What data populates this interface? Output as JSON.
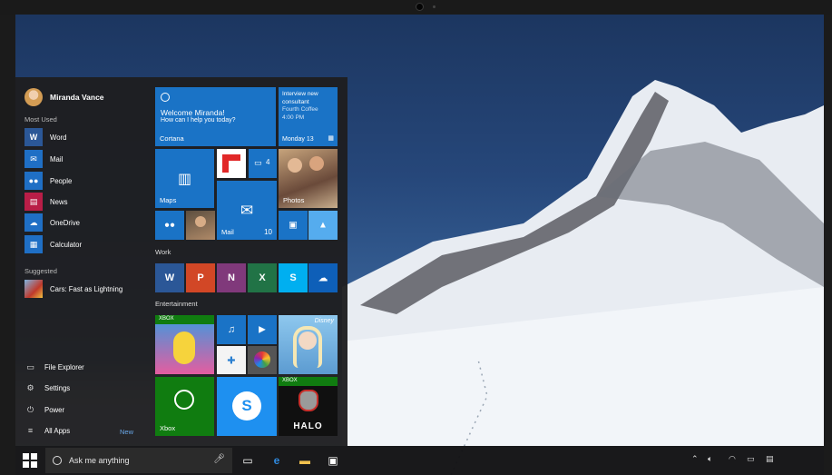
{
  "user": {
    "name": "Miranda Vance"
  },
  "sections": {
    "most_used": "Most Used",
    "suggested": "Suggested",
    "work": "Work",
    "entertainment": "Entertainment"
  },
  "most_used": [
    {
      "label": "Word",
      "icon": "W",
      "color": "#2b5797"
    },
    {
      "label": "Mail",
      "icon": "✉",
      "color": "#1f6fc5"
    },
    {
      "label": "People",
      "icon": "👥",
      "color": "#1f6fc5"
    },
    {
      "label": "News",
      "icon": "▤",
      "color": "#b91d47"
    },
    {
      "label": "OneDrive",
      "icon": "☁",
      "color": "#1f6fc5"
    },
    {
      "label": "Calculator",
      "icon": "▦",
      "color": "#1f6fc5"
    }
  ],
  "suggested": [
    {
      "label": "Cars: Fast as Lightning",
      "color": "#c0392b"
    }
  ],
  "system": [
    {
      "label": "File Explorer",
      "icon": "🗀"
    },
    {
      "label": "Settings",
      "icon": "⚙"
    },
    {
      "label": "Power",
      "icon": "⏻"
    },
    {
      "label": "All Apps",
      "icon": "≡"
    }
  ],
  "all_apps_badge": "New",
  "tiles": {
    "cortana": {
      "title": "Welcome Miranda!",
      "subtitle": "How can I help you today?",
      "label": "Cortana"
    },
    "calendar": {
      "line1": "Interview new",
      "line2": "consultant",
      "line3": "Fourth Coffee",
      "line4": "4:00 PM",
      "date": "Monday 13"
    },
    "maps": {
      "label": "Maps"
    },
    "messaging": {
      "count": "4"
    },
    "photos": {
      "label": "Photos"
    },
    "mail": {
      "label": "Mail",
      "count": "10"
    },
    "xbox_small": "XBOX",
    "disney": "Disney",
    "xbox": {
      "label": "Xbox"
    },
    "halo": "HALO"
  },
  "work_tiles": [
    {
      "name": "word",
      "letter": "W",
      "color": "#2b5797"
    },
    {
      "name": "powerpoint",
      "letter": "P",
      "color": "#d24726"
    },
    {
      "name": "onenote",
      "letter": "N",
      "color": "#80397b"
    },
    {
      "name": "excel",
      "letter": "X",
      "color": "#217346"
    },
    {
      "name": "skype",
      "letter": "S",
      "color": "#00aff0"
    },
    {
      "name": "onedrive",
      "letter": "☁",
      "color": "#0e5fb8"
    }
  ],
  "taskbar": {
    "search_placeholder": "Ask me anything"
  },
  "colors": {
    "accent": "#1a73c6",
    "start_bg": "#1e1e20"
  }
}
